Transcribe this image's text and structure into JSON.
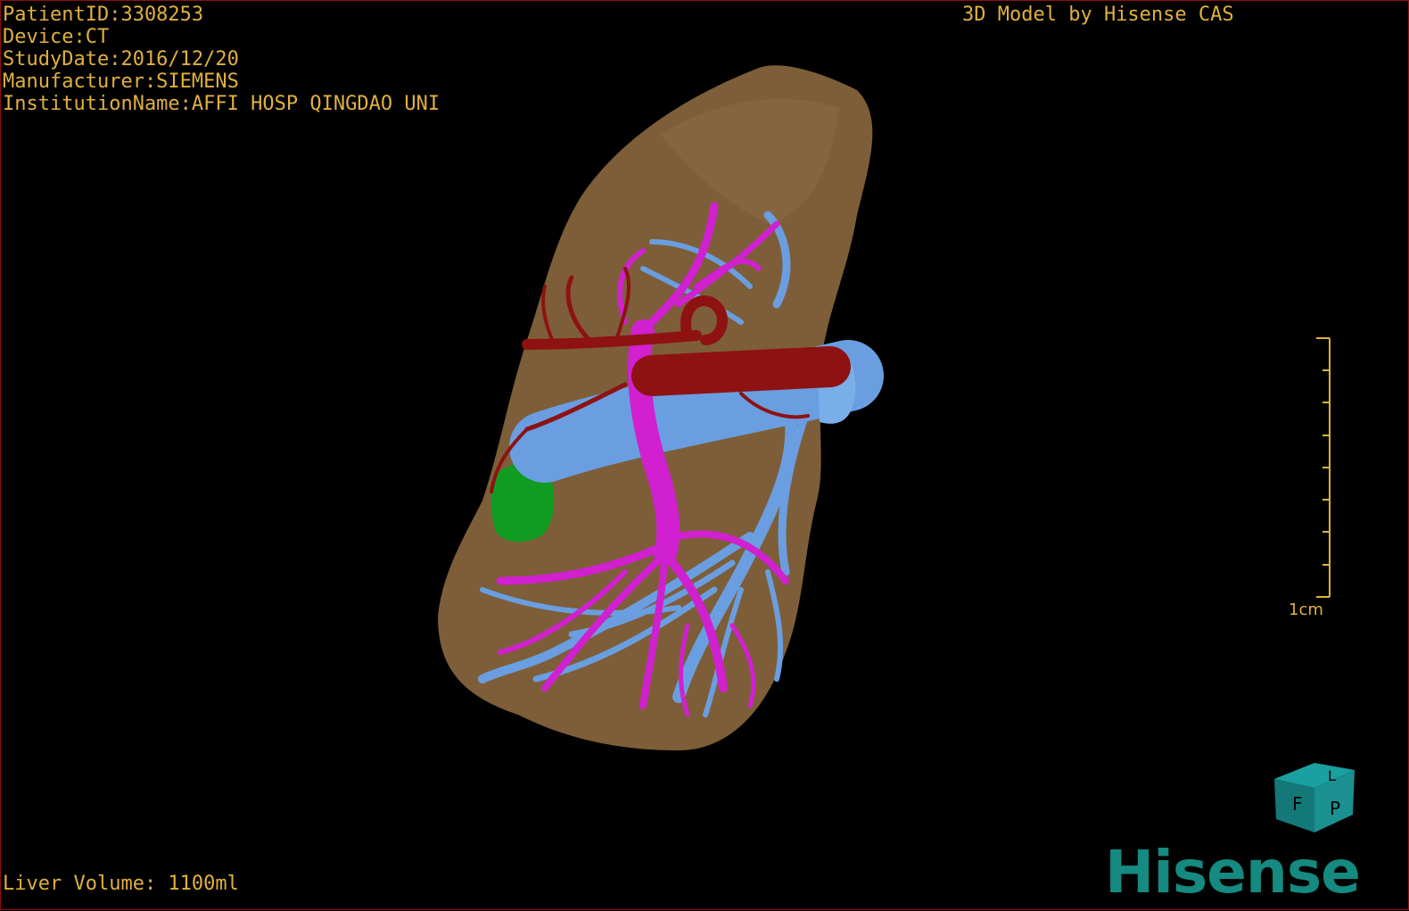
{
  "overlay": {
    "patient_id": "PatientID:3308253",
    "device": "Device:CT",
    "study_date": "StudyDate:2016/12/20",
    "manufacturer": "Manufacturer:SIEMENS",
    "institution": "InstitutionName:AFFI HOSP QINGDAO UNI",
    "credit": "3D Model by Hisense CAS",
    "liver_volume": "Liver Volume: 1100ml"
  },
  "scale_bar": {
    "label": "1cm"
  },
  "orientation_cube": {
    "faces": [
      "F",
      "P",
      "L"
    ]
  },
  "brand": {
    "logo_text": "Hisense"
  },
  "colors": {
    "text": "#e0b040",
    "liver": "#7d5e38",
    "artery": "#8e1212",
    "portal_vein": "#d020d0",
    "hepatic_vein": "#6a9ee0",
    "gallbladder": "#109c20",
    "brand": "#148a80"
  }
}
